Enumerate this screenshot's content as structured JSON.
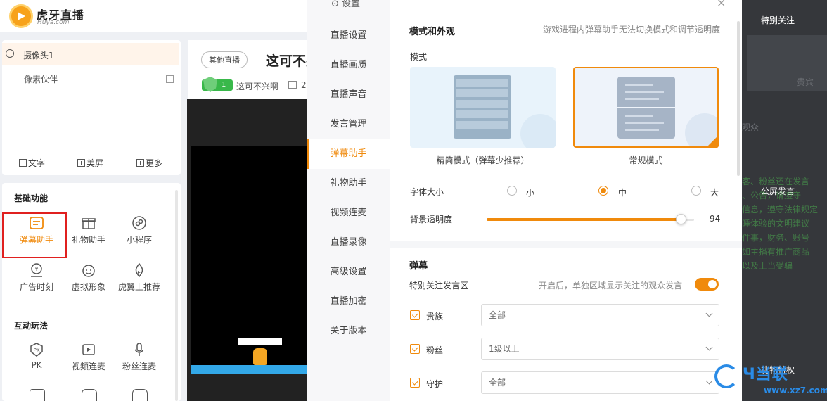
{
  "brand": {
    "name_cn": "虎牙直播",
    "name_en": "Huya.com"
  },
  "left": {
    "camera": "摄像头1",
    "source": "像素伙伴",
    "add_buttons": [
      "文字",
      "美屏",
      "更多"
    ],
    "basic_title": "基础功能",
    "basic_tools": [
      {
        "label": "弹幕助手",
        "icon": "danmu-icon"
      },
      {
        "label": "礼物助手",
        "icon": "gift-icon"
      },
      {
        "label": "小程序",
        "icon": "miniapp-icon"
      },
      {
        "label": "广告时刻",
        "icon": "ad-icon"
      },
      {
        "label": "虚拟形象",
        "icon": "avatar-face-icon"
      },
      {
        "label": "虎翼上推荐",
        "icon": "recommend-icon"
      }
    ],
    "interactive_title": "互动玩法",
    "interactive_tools": [
      {
        "label": "PK",
        "icon": "pk-icon"
      },
      {
        "label": "视频连麦",
        "icon": "video-link-icon"
      },
      {
        "label": "粉丝连麦",
        "icon": "mic-icon"
      }
    ]
  },
  "stream": {
    "tag": "其他直播",
    "title": "这可不兴啊",
    "level": "1",
    "nick": "这可不兴啊",
    "room_prefix": "2"
  },
  "settings": {
    "nav_header": "设置",
    "nav": [
      "直播设置",
      "直播画质",
      "直播声音",
      "发言管理",
      "弹幕助手",
      "礼物助手",
      "视频连麦",
      "直播录像",
      "高级设置",
      "直播加密",
      "关于版本"
    ],
    "active_nav": "弹幕助手",
    "mode_section": {
      "title": "模式和外观",
      "note": "游戏进程内弹幕助手无法切换模式和调节透明度",
      "mode_label": "模式",
      "mode_simple": "精简模式（弹幕少推荐）",
      "mode_normal": "常规模式",
      "selected": "常规模式"
    },
    "font_size": {
      "label": "字体大小",
      "options": [
        "小",
        "中",
        "大"
      ],
      "selected": "中"
    },
    "opacity": {
      "label": "背景透明度",
      "value": 94,
      "max": 100
    },
    "danmu_section": {
      "title": "弹幕",
      "follow_area_label": "特别关注发言区",
      "follow_area_note": "开启后，单独区域显示关注的观众发言",
      "follow_area_on": true,
      "filters": [
        {
          "label": "贵族",
          "value": "全部",
          "checked": true
        },
        {
          "label": "粉丝",
          "value": "1级以上",
          "checked": true
        },
        {
          "label": "守护",
          "value": "全部",
          "checked": true
        }
      ]
    }
  },
  "right": {
    "special_follow": "特别关注",
    "public_msg": "公屏发言",
    "gift_special": "礼物特权",
    "ghost_1": "贵宾",
    "ghost_2": "观众",
    "green_lines": "客、粉丝还在发言\n、公告，请遵守\n信息，遵守法律规定\n睡体验的文明建议\n件事，财务、账号\n如主播有推广商品\n以及上当受骗"
  },
  "watermark": {
    "cn": "Ч当联",
    "url": "www.xz7.com"
  },
  "colors": {
    "accent": "#f08a0c",
    "highlight": "#e0201f",
    "green": "#39b84a",
    "dark": "#35373b"
  }
}
